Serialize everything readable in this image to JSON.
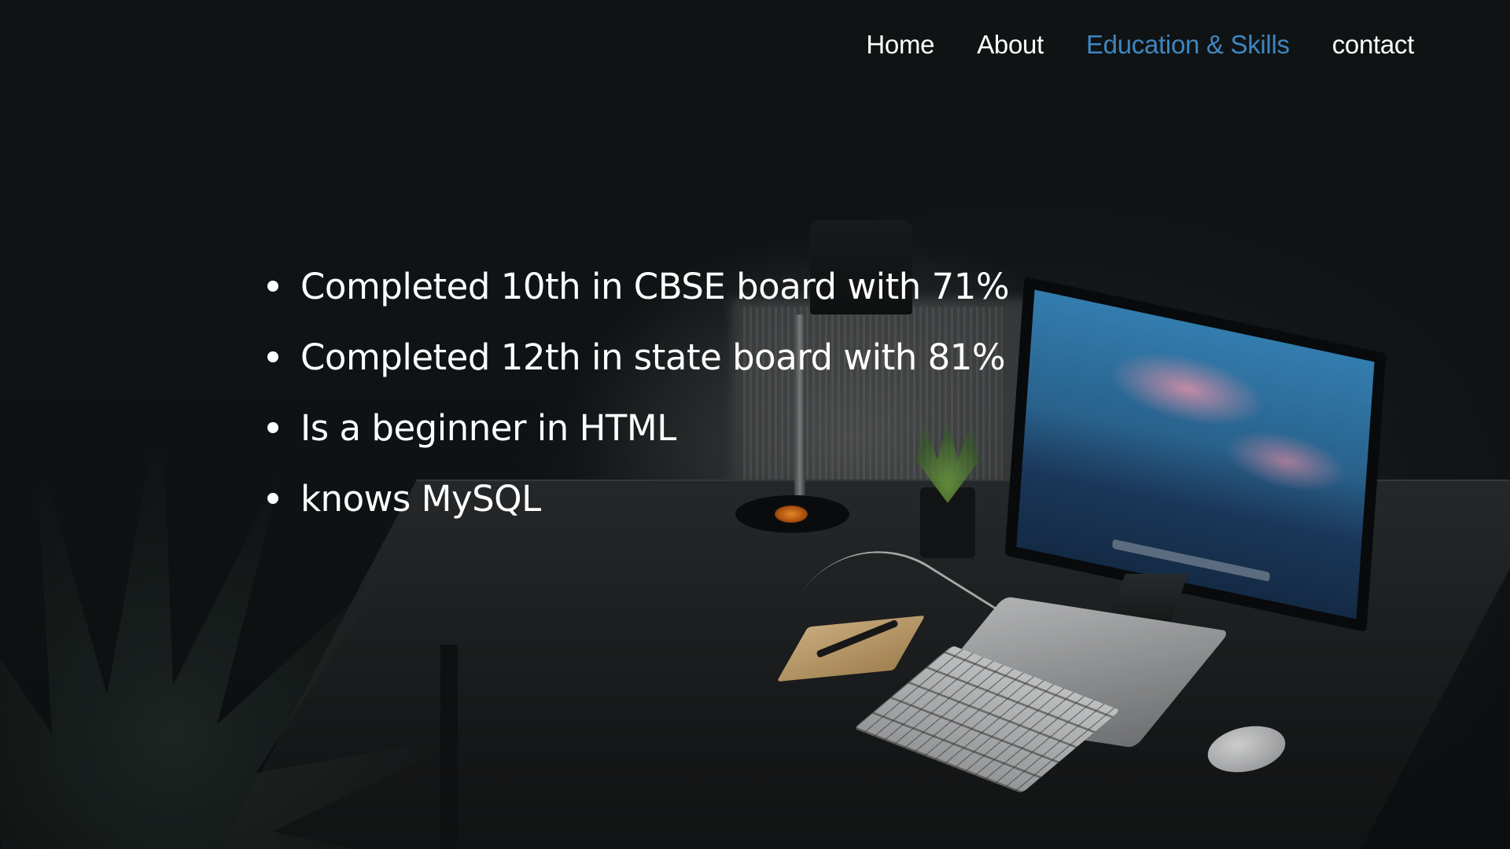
{
  "nav": {
    "items": [
      {
        "label": "Home",
        "active": false
      },
      {
        "label": "About",
        "active": false
      },
      {
        "label": "Education & Skills",
        "active": true
      },
      {
        "label": "contact",
        "active": false
      }
    ],
    "active_color": "#3f86bf",
    "text_color": "#ffffff"
  },
  "content": {
    "items": [
      "Completed 10th in CBSE board with 71%",
      "Completed 12th in state board with 81%",
      "Is a beginner in HTML",
      "knows MySQL"
    ]
  },
  "background": {
    "image": "dark-desk-workspace-photo",
    "overlay_color": "#0f1314"
  }
}
